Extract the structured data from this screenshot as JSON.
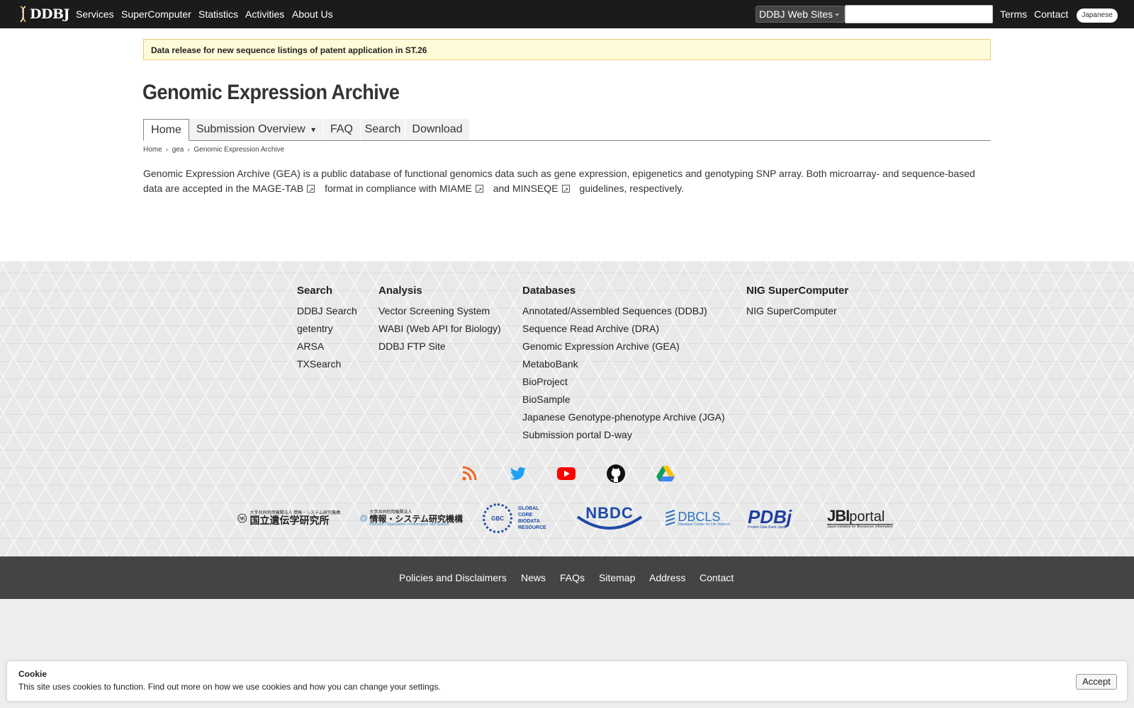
{
  "topnav": {
    "logo_text": "DDBJ",
    "links": [
      "Services",
      "SuperComputer",
      "Statistics",
      "Activities",
      "About Us"
    ],
    "site_select": "DDBJ Web Sites",
    "search_value": "",
    "right_links": [
      "Terms",
      "Contact"
    ],
    "lang_button": "Japanese"
  },
  "banner": {
    "text": "Data release for new sequence listings of patent application in ST.26"
  },
  "page": {
    "title": "Genomic Expression Archive"
  },
  "subnav": {
    "tabs": [
      "Home",
      "Submission Overview",
      "FAQ",
      "Search",
      "Download"
    ],
    "active": "Home",
    "dropdown_caret": "▾"
  },
  "breadcrumb": [
    "Home",
    "gea",
    "Genomic Expression Archive"
  ],
  "intro": {
    "part1": "Genomic Expression Archive (GEA) is a public database of functional genomics data such as gene expression, epigenetics and genotyping SNP array. Both microarray- and sequence-based data are accepted in the",
    "link1": "MAGE-TAB",
    "part2": "format in compliance with",
    "link2": "MIAME",
    "part3": "and",
    "link3": "MINSEQE",
    "part4": "guidelines, respectively."
  },
  "footer": {
    "search": {
      "heading": "Search",
      "links": [
        "DDBJ Search",
        "getentry",
        "ARSA",
        "TXSearch"
      ]
    },
    "analysis": {
      "heading": "Analysis",
      "links": [
        "Vector Screening System",
        "WABI (Web API for Biology)",
        "DDBJ FTP Site"
      ]
    },
    "databases": {
      "heading": "Databases",
      "links": [
        "Annotated/Assembled Sequences (DDBJ)",
        "Sequence Read Archive (DRA)",
        "Genomic Expression Archive (GEA)",
        "MetaboBank",
        "BioProject",
        "BioSample",
        "Japanese Genotype-phenotype Archive (JGA)",
        "Submission portal D-way"
      ]
    },
    "supercomputer": {
      "heading": "NIG SuperComputer",
      "links": [
        "NIG SuperComputer"
      ]
    },
    "social_icons": [
      "rss-icon",
      "twitter-icon",
      "youtube-icon",
      "github-icon",
      "google-drive-icon"
    ],
    "orgs": {
      "nig": {
        "sub": "大学共同利用機関法人 情報・システム研究機構",
        "main": "国立遺伝学研究所"
      },
      "rois": {
        "sub": "大学共同利用機関法人",
        "main": "情報・システム研究機構",
        "en": "Research Organization of Information and Systems"
      },
      "gcbr": {
        "badge": "GBC",
        "lines": [
          "GLOBAL",
          "CORE",
          "BIODATA",
          "RESOURCE"
        ]
      },
      "nbdc": {
        "text": "NBDC"
      },
      "dbcls": {
        "text": "DBCLS",
        "sub": "Database Center for Life Science"
      },
      "pdbj": {
        "text": "PDBj",
        "sub": "Protein Data Bank Japan"
      },
      "jbi": {
        "text": "JBI",
        "portal": "portal",
        "sub": "Japan Initiative for Bioscience Information"
      }
    }
  },
  "bottombar": {
    "links": [
      "Policies and Disclaimers",
      "News",
      "FAQs",
      "Sitemap",
      "Address",
      "Contact"
    ]
  },
  "cookie": {
    "title": "Cookie",
    "text_before": "This site uses cookies to function.",
    "link": "Find out more",
    "text_after": "on how we use cookies and how you can change your settings.",
    "accept": "Accept"
  },
  "colors": {
    "topnav_bg": "#1b1b1b",
    "banner_bg": "#fffbd9",
    "bottombar_bg": "#444444",
    "rss": "#f26522",
    "twitter": "#1da1f2",
    "youtube": "#ff0000",
    "nbdc": "#1d4aa8",
    "pdbj": "#1e3fa0"
  }
}
